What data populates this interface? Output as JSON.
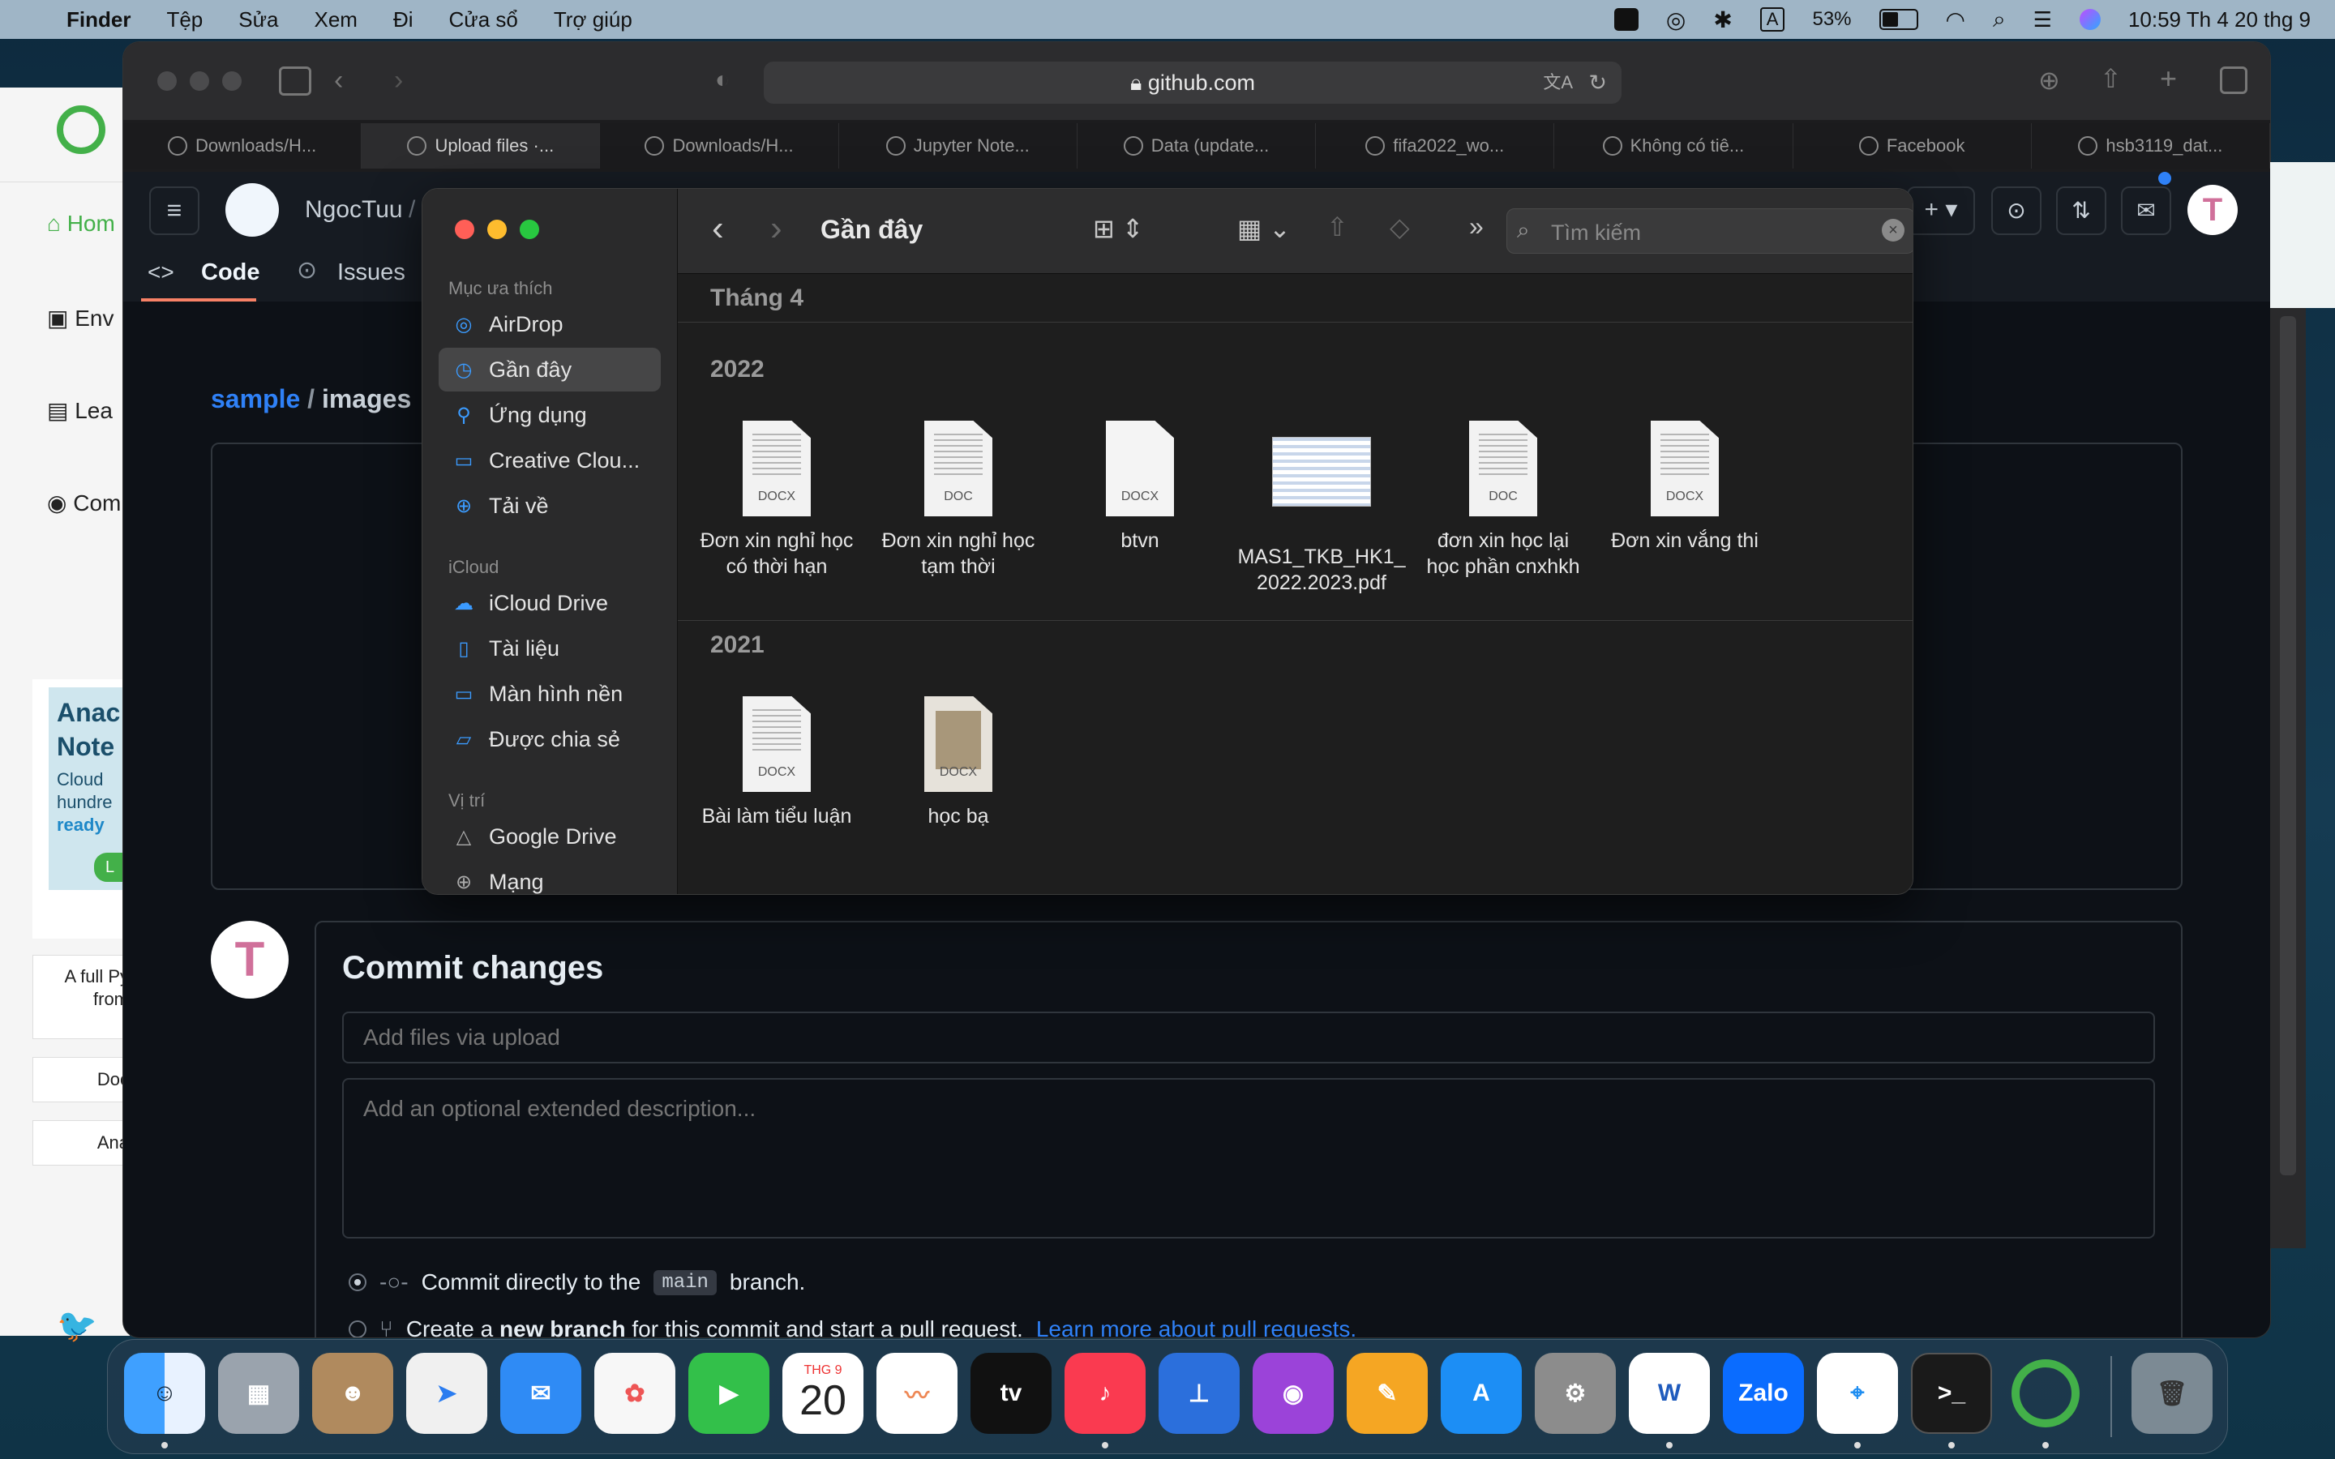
{
  "menubar": {
    "app": "Finder",
    "items": [
      "Tệp",
      "Sửa",
      "Xem",
      "Đi",
      "Cửa sổ",
      "Trợ giúp"
    ],
    "battery_percent": "53%",
    "battery_level": 0.53,
    "keyboard": "A",
    "clock": "10:59 Th 4 20 thg 9"
  },
  "background_page": {
    "nav": [
      "Hom",
      "Env",
      "Lea",
      "Com"
    ],
    "promo_lines": [
      "Anac",
      "Note",
      "Cloud",
      "hundre",
      "ready"
    ],
    "promo_button": "L",
    "desc_lines": [
      "A full Py",
      "from"
    ],
    "links": [
      "Doc",
      "Ana"
    ]
  },
  "safari": {
    "url": "github.com",
    "tabs": [
      "Downloads/H...",
      "Upload files ·...",
      "Downloads/H...",
      "Jupyter Note...",
      "Data (update...",
      "fifa2022_wo...",
      "Không có tiê...",
      "Facebook",
      "hsb3119_dat..."
    ]
  },
  "github": {
    "user": "NgocTuu",
    "separator": "/",
    "tabs": {
      "code": "Code",
      "issues": "Issues"
    },
    "path": {
      "repo": "sample",
      "sep": "/",
      "dir": "images"
    },
    "commit": {
      "title": "Commit changes",
      "summary_placeholder": "Add files via upload",
      "description_placeholder": "Add an optional extended description...",
      "option1_pre": "Commit directly to the",
      "branch": "main",
      "option1_post": "branch.",
      "option2_pre": "Create a",
      "option2_bold": "new branch",
      "option2_post": "for this commit and start a pull request.",
      "learn_more": "Learn more about pull requests."
    }
  },
  "finder": {
    "title": "Gần đây",
    "search_placeholder": "Tìm kiếm",
    "sidebar": {
      "favorites_header": "Mục ưa thích",
      "favorites": [
        {
          "label": "AirDrop",
          "icon": "airdrop-icon"
        },
        {
          "label": "Gần đây",
          "icon": "clock-icon",
          "selected": true
        },
        {
          "label": "Ứng dụng",
          "icon": "applications-icon"
        },
        {
          "label": "Creative Clou...",
          "icon": "folder-icon"
        },
        {
          "label": "Tải về",
          "icon": "download-icon"
        }
      ],
      "icloud_header": "iCloud",
      "icloud": [
        {
          "label": "iCloud Drive",
          "icon": "cloud-icon"
        },
        {
          "label": "Tài liệu",
          "icon": "document-icon"
        },
        {
          "label": "Màn hình nền",
          "icon": "desktop-icon"
        },
        {
          "label": "Được chia sẻ",
          "icon": "shared-folder-icon"
        }
      ],
      "locations_header": "Vị trí",
      "locations": [
        {
          "label": "Google Drive",
          "icon": "drive-icon"
        },
        {
          "label": "Mạng",
          "icon": "globe-icon"
        }
      ]
    },
    "sections": [
      {
        "header": "Tháng 4",
        "files": []
      },
      {
        "header": "2022",
        "files": [
          {
            "line1": "Đơn xin nghỉ học",
            "line2": "có thời hạn",
            "type": "DOCX"
          },
          {
            "line1": "Đơn xin nghỉ học",
            "line2": "tạm thời",
            "type": "DOC"
          },
          {
            "line1": "btvn",
            "line2": "",
            "type": "DOCX"
          },
          {
            "line1": "MAS1_TKB_HK1_",
            "line2": "2022.2023.pdf",
            "type": "PDF"
          },
          {
            "line1": "đơn xin học lại",
            "line2": "học phần cnxhkh",
            "type": "DOC"
          },
          {
            "line1": "Đơn xin vắng thi",
            "line2": "",
            "type": "DOCX"
          }
        ]
      },
      {
        "header": "2021",
        "files": [
          {
            "line1": "Bài làm tiểu luận",
            "line2": "",
            "type": "DOCX"
          },
          {
            "line1": "học bạ",
            "line2": "",
            "type": "DOCX"
          }
        ]
      }
    ]
  },
  "dock": {
    "calendar_month": "THG 9",
    "calendar_day": "20",
    "tv_label": "tv",
    "zalo_label": "Zalo",
    "word_label": "W"
  }
}
